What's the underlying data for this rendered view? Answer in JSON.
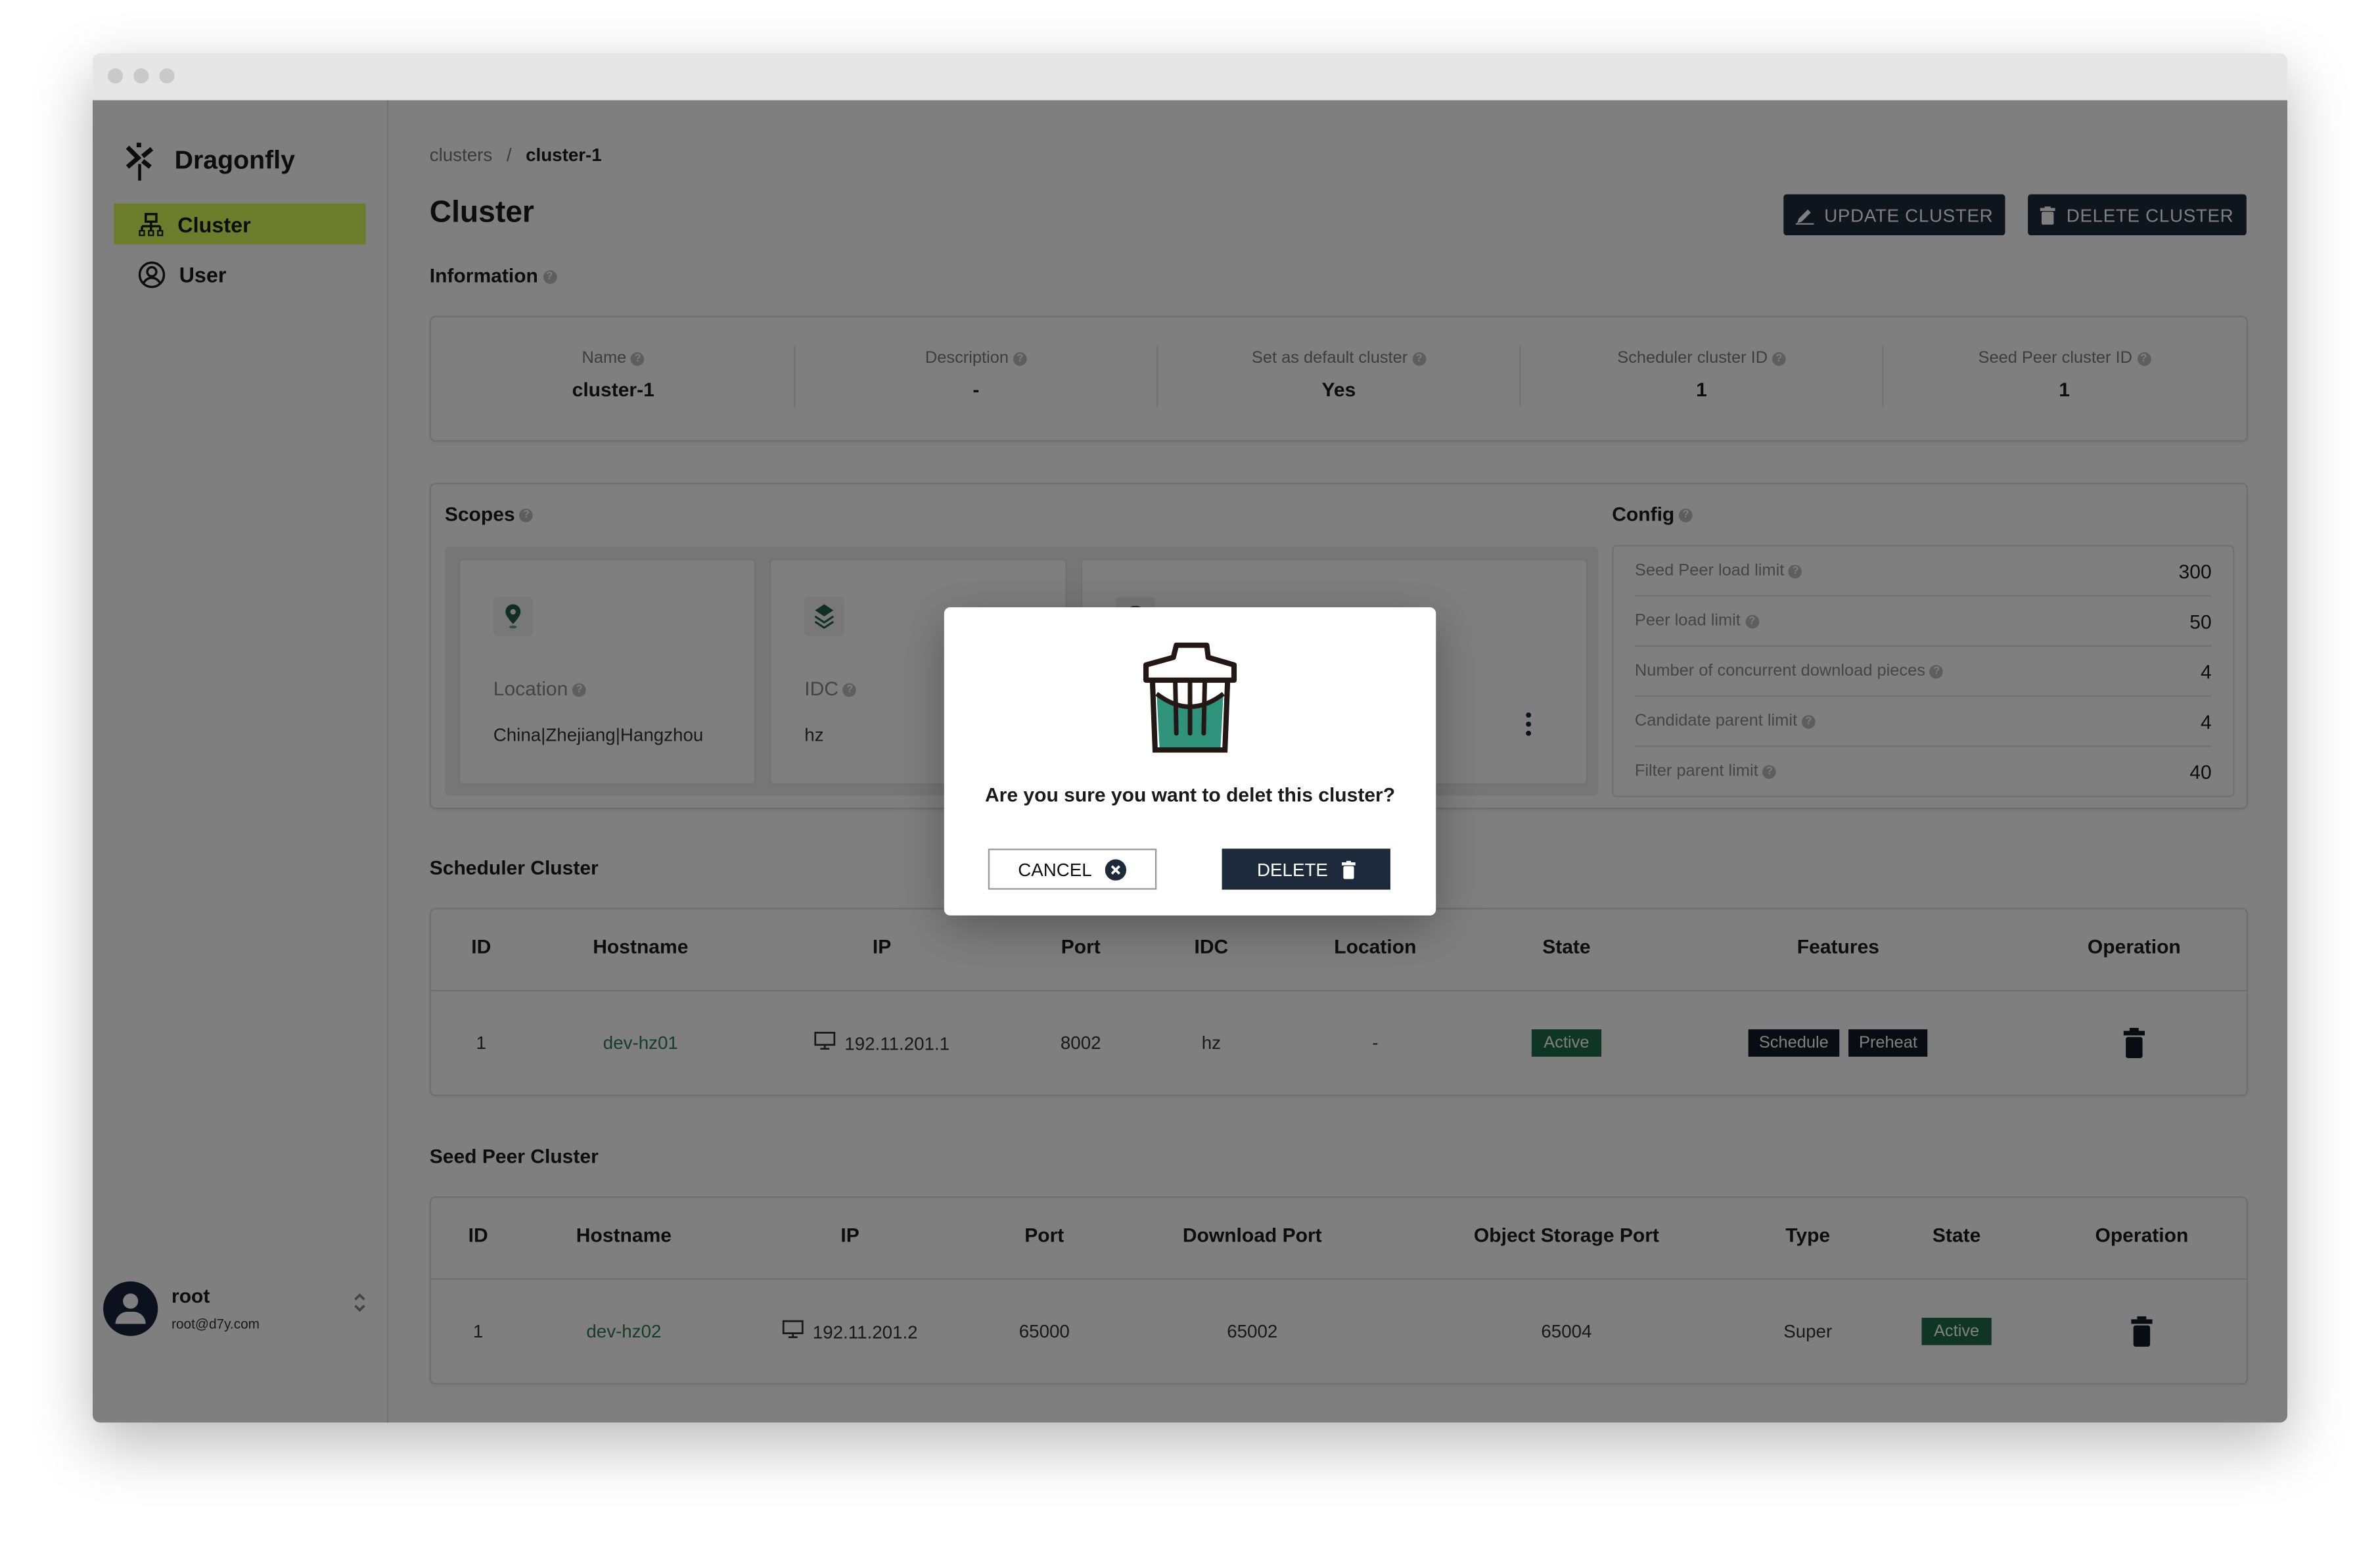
{
  "app": {
    "name": "Dragonfly"
  },
  "sidebar": {
    "items": [
      {
        "label": "Cluster",
        "icon": "cluster-icon",
        "active": true
      },
      {
        "label": "User",
        "icon": "user-circle-icon",
        "active": false
      }
    ],
    "user": {
      "name": "root",
      "email": "root@d7y.com"
    }
  },
  "breadcrumb": {
    "parent": "clusters",
    "separator": "/",
    "current": "cluster-1"
  },
  "header": {
    "title": "Cluster",
    "update_label": "UPDATE CLUSTER",
    "delete_label": "DELETE CLUSTER"
  },
  "information": {
    "title": "Information",
    "fields": [
      {
        "label": "Name",
        "value": "cluster-1"
      },
      {
        "label": "Description",
        "value": "-"
      },
      {
        "label": "Set as default cluster",
        "value": "Yes"
      },
      {
        "label": "Scheduler cluster ID",
        "value": "1"
      },
      {
        "label": "Seed Peer cluster ID",
        "value": "1"
      }
    ]
  },
  "scopes": {
    "title": "Scopes",
    "items": [
      {
        "label": "Location",
        "value": "China|Zhejiang|Hangzhou",
        "icon": "location-pin-icon"
      },
      {
        "label": "IDC",
        "value": "hz",
        "icon": "layers-icon"
      }
    ]
  },
  "config": {
    "title": "Config",
    "rows": [
      {
        "label": "Seed Peer load limit",
        "value": "300"
      },
      {
        "label": "Peer load limit",
        "value": "50"
      },
      {
        "label": "Number of concurrent download pieces",
        "value": "4"
      },
      {
        "label": "Candidate parent limit",
        "value": "4"
      },
      {
        "label": "Filter parent limit",
        "value": "40"
      }
    ]
  },
  "scheduler_cluster": {
    "title": "Scheduler Cluster",
    "columns": [
      "ID",
      "Hostname",
      "IP",
      "Port",
      "IDC",
      "Location",
      "State",
      "Features",
      "Operation"
    ],
    "rows": [
      {
        "id": "1",
        "hostname": "dev-hz01",
        "ip": "192.11.201.1",
        "port": "8002",
        "idc": "hz",
        "location": "-",
        "state": "Active",
        "features": [
          "Schedule",
          "Preheat"
        ]
      }
    ]
  },
  "seed_peer_cluster": {
    "title": "Seed Peer Cluster",
    "columns": [
      "ID",
      "Hostname",
      "IP",
      "Port",
      "Download Port",
      "Object Storage Port",
      "Type",
      "State",
      "Operation"
    ],
    "rows": [
      {
        "id": "1",
        "hostname": "dev-hz02",
        "ip": "192.11.201.2",
        "port": "65000",
        "download_port": "65002",
        "object_storage_port": "65004",
        "type": "Super",
        "state": "Active"
      }
    ]
  },
  "dialog": {
    "message": "Are you sure you want to delet this cluster?",
    "cancel_label": "CANCEL",
    "delete_label": "DELETE"
  },
  "colors": {
    "accent": "#dcfa58",
    "primary": "#1c2a3b",
    "active_badge": "#1f6b4f",
    "link": "#2b7a5b",
    "trash_fill": "#2f927a"
  }
}
